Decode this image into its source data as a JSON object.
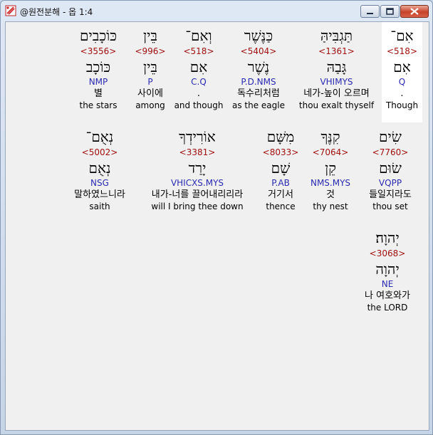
{
  "window": {
    "title": "@원전분해 - 옵 1:4",
    "buttons": {
      "minimize": "–",
      "maximize": "□",
      "close": "✕"
    }
  },
  "rows": [
    [
      {
        "hebrew": "אִם־",
        "strong": "<518>",
        "lemma": "אִם",
        "morph": "Q",
        "korean": ".",
        "english": "Though",
        "highlighted": true
      },
      {
        "hebrew": "תַּגְבִּיהַּ",
        "strong": "<1361>",
        "lemma": "גָּבַהּ",
        "morph": "VHIMYS",
        "korean": "네가-높이 오르며",
        "english": "thou exalt thyself",
        "highlighted": false
      },
      {
        "hebrew": "כַּנֶּשֶׁר",
        "strong": "<5404>",
        "lemma": "נֶשֶׁר",
        "morph": "P.D.NMS",
        "korean": "독수리처럼",
        "english": "as the eagle",
        "highlighted": false
      },
      {
        "hebrew": "וְאִם־",
        "strong": "<518>",
        "lemma": "אִם",
        "morph": "C.Q",
        "korean": ".",
        "english": "and though",
        "highlighted": false
      },
      {
        "hebrew": "בֵּין",
        "strong": "<996>",
        "lemma": "בֵּין",
        "morph": "P",
        "korean": "사이에",
        "english": "among",
        "highlighted": false
      },
      {
        "hebrew": "כּוֹכָבִים",
        "strong": "<3556>",
        "lemma": "כּוֹכָב",
        "morph": "NMP",
        "korean": "별",
        "english": "the stars",
        "highlighted": false
      }
    ],
    [
      {
        "hebrew": "שִׂים",
        "strong": "<7760>",
        "lemma": "שׂוּם",
        "morph": "VQPP",
        "korean": "들일지라도",
        "english": "thou set",
        "highlighted": false
      },
      {
        "hebrew": "קִנֶּךָ",
        "strong": "<7064>",
        "lemma": "קֵן",
        "morph": "NMS.MYS",
        "korean": "것",
        "english": "thy nest",
        "highlighted": false
      },
      {
        "hebrew": "מִשָּׁם",
        "strong": "<8033>",
        "lemma": "שָׁם",
        "morph": "P.AB",
        "korean": "거기서",
        "english": "thence",
        "highlighted": false
      },
      {
        "hebrew": "אוֹרִידְךָ",
        "strong": "<3381>",
        "lemma": "יָרַד",
        "morph": "VHICXS.MYS",
        "korean": "내가-너를 끌어내리리라",
        "english": "will I bring thee down",
        "highlighted": false
      },
      {
        "hebrew": "נְאֻם־",
        "strong": "<5002>",
        "lemma": "נְאֻם",
        "morph": "NSG",
        "korean": "말하였느니라",
        "english": "saith",
        "highlighted": false
      }
    ],
    [
      {
        "hebrew": "יְהוָה׃",
        "strong": "<3068>",
        "lemma": "יְהוָה",
        "morph": "NE",
        "korean": "나 여호와가",
        "english": "the LORD",
        "highlighted": false
      }
    ]
  ]
}
